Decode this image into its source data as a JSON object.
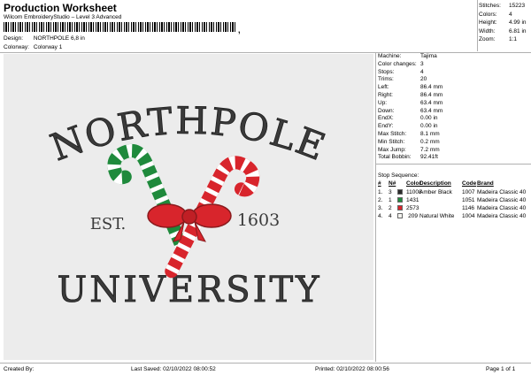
{
  "header": {
    "title": "Production Worksheet",
    "subtitle": "Wilcom EmbroideryStudio – Level 3 Advanced",
    "barcode_tail": ",",
    "design_label": "Design:",
    "design_value": "NORTHPOLE 6,8 in",
    "colorway_label": "Colorway:",
    "colorway_value": "Colorway 1"
  },
  "stats": [
    {
      "k": "Stitches:",
      "v": "15223"
    },
    {
      "k": "Colors:",
      "v": "4"
    },
    {
      "k": "Height:",
      "v": "4.99 in"
    },
    {
      "k": "Width:",
      "v": "6.81 in"
    },
    {
      "k": "Zoom:",
      "v": "1:1"
    }
  ],
  "design": {
    "top_word": "NORTHPOLE",
    "bottom_word": "UNIVERSITY",
    "left_text": "EST.",
    "right_text": "1603"
  },
  "machine_info": [
    {
      "k": "Machine:",
      "v": "Tajima"
    },
    {
      "k": "Color changes:",
      "v": "3"
    },
    {
      "k": "Stops:",
      "v": "4"
    },
    {
      "k": "Trims:",
      "v": "20"
    },
    {
      "k": "Left:",
      "v": "86.4 mm"
    },
    {
      "k": "Right:",
      "v": "86.4 mm"
    },
    {
      "k": "Up:",
      "v": "63.4 mm"
    },
    {
      "k": "Down:",
      "v": "63.4 mm"
    },
    {
      "k": "EndX:",
      "v": "0.00 in"
    },
    {
      "k": "EndY:",
      "v": "0.00 in"
    },
    {
      "k": "Max Stitch:",
      "v": "8.1 mm"
    },
    {
      "k": "Min Stitch:",
      "v": "0.2 mm"
    },
    {
      "k": "Max Jump:",
      "v": "7.2 mm"
    },
    {
      "k": "Total Bobbin:",
      "v": "92.41ft"
    }
  ],
  "stop_sequence": {
    "title": "Stop Sequence:",
    "headers": [
      "#",
      "N#",
      "Color",
      "Description",
      "Code",
      "Brand"
    ],
    "rows": [
      {
        "n": "1.",
        "nn": "3",
        "swatch": "#2b2b2b",
        "color": "11008",
        "desc": "Amber Black",
        "code": "1007",
        "brand": "Madeira Classic 40"
      },
      {
        "n": "2.",
        "nn": "1",
        "swatch": "#1f8a3c",
        "color": "1431",
        "desc": "",
        "code": "1051",
        "brand": "Madeira Classic 40"
      },
      {
        "n": "3.",
        "nn": "2",
        "swatch": "#d8252c",
        "color": "2573",
        "desc": "",
        "code": "1146",
        "brand": "Madeira Classic 40"
      },
      {
        "n": "4.",
        "nn": "4",
        "swatch": "#f4f4f0",
        "color": "209",
        "desc": "Natural White",
        "code": "1004",
        "brand": "Madeira Classic 40"
      }
    ]
  },
  "footer": {
    "created": "Created By:",
    "saved": "Last Saved: 02/10/2022 08:00:52",
    "printed": "Printed: 02/10/2022 08:00:56",
    "page": "Page 1 of 1"
  }
}
